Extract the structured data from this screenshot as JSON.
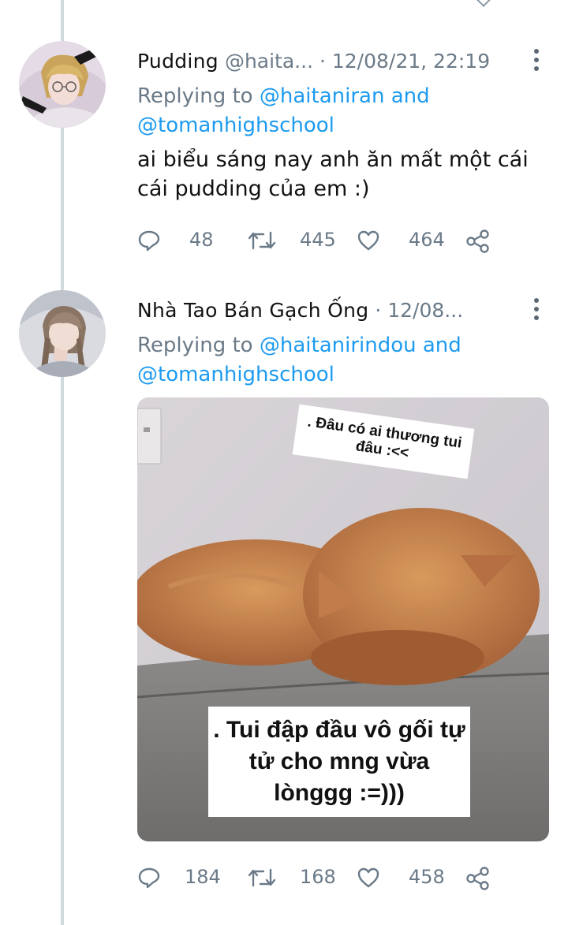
{
  "tweets": [
    {
      "name": "Pudding",
      "handle": "@haita...",
      "dot": "·",
      "time": "12/08/21, 22:19",
      "reply_prefix": "Replying to",
      "mention1": "@haitaniran",
      "reply_and": "and",
      "mention2": "@tomanhighschool",
      "text": "ai biểu sáng nay anh ăn mất một cái cái pudding của em :)",
      "replies": "48",
      "retweets": "445",
      "likes": "464"
    },
    {
      "name": "Nhà Tao Bán Gạch Ống",
      "dot": "·",
      "time": "12/08...",
      "reply_prefix": "Replying to",
      "mention1": "@haitanirindou",
      "reply_and": "and",
      "mention2": "@tomanhighschool",
      "image_caption_top": ". Đâu có ai thương tui đâu :<<",
      "image_caption_bottom": ". Tui đập đầu vô gối tự tử cho mng vừa lònggg :=)))",
      "replies": "184",
      "retweets": "168",
      "likes": "458"
    }
  ],
  "colors": {
    "mention": "#1d9bf0",
    "muted": "#6b7a88",
    "thread_line": "#cfd9de"
  },
  "icons": [
    "reply-icon",
    "retweet-icon",
    "like-icon",
    "share-icon",
    "more-icon"
  ]
}
